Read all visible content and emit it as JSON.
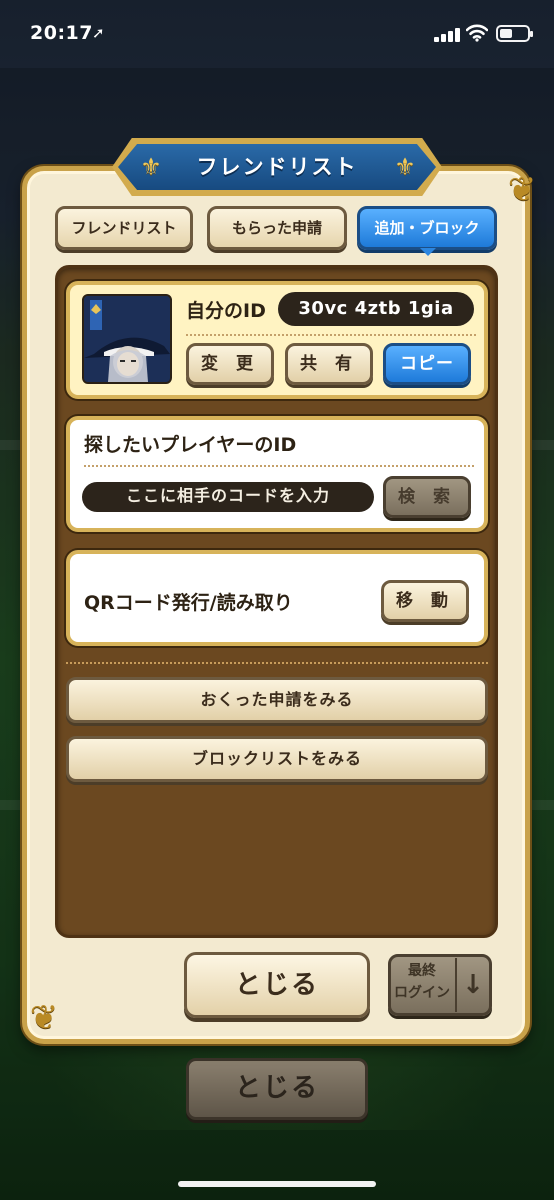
{
  "status_bar": {
    "time": "20:17",
    "location_glyph": "➚",
    "battery_level": 0.45
  },
  "dialog": {
    "title": "フレンドリスト",
    "tabs": [
      {
        "label": "フレンドリスト",
        "active": false
      },
      {
        "label": "もらった申請",
        "active": false
      },
      {
        "label": "追加・ブロック",
        "active": true
      }
    ]
  },
  "my_id_card": {
    "label": "自分のID",
    "id_value": "30vc 4ztb 1gia",
    "buttons": {
      "change": "変 更",
      "share": "共 有",
      "copy": "コピー"
    }
  },
  "search_card": {
    "label": "探したいプレイヤーのID",
    "input_placeholder": "ここに相手のコードを入力",
    "search_button": "検 索"
  },
  "qr_card": {
    "label": "QRコード発行/読み取り",
    "move_button": "移 動"
  },
  "list_buttons": {
    "sent_requests": "おくった申請をみる",
    "block_list": "ブロックリストをみる"
  },
  "footer": {
    "close": "とじる",
    "sort_label": "最終\nログイン",
    "sort_arrow": "↓"
  },
  "background": {
    "close": "とじる"
  },
  "colors": {
    "accent_blue": "#1e7ad9",
    "gold_border": "#c9a24a",
    "panel_brown": "#6b4820",
    "title_blue": "#174a80"
  }
}
